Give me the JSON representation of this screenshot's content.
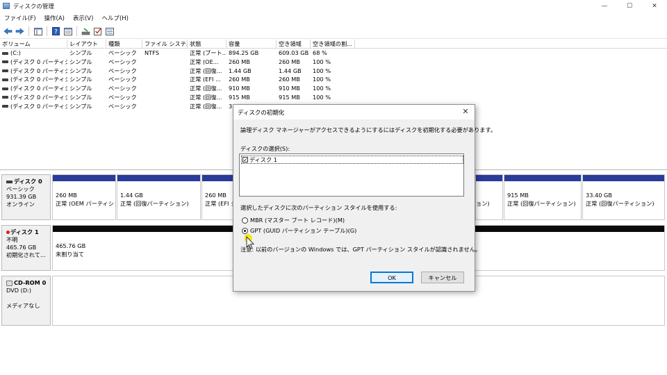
{
  "window": {
    "title": "ディスクの管理"
  },
  "menu": [
    {
      "label": "ファイル(F)"
    },
    {
      "label": "操作(A)"
    },
    {
      "label": "表示(V)"
    },
    {
      "label": "ヘルプ(H)"
    }
  ],
  "volumes": {
    "columns": [
      "ボリューム",
      "レイアウト",
      "種類",
      "ファイル システム",
      "状態",
      "容量",
      "空き領域",
      "空き領域の割..."
    ],
    "rows": [
      {
        "vol": "(C:)",
        "layout": "シンプル",
        "type": "ベーシック",
        "fs": "NTFS",
        "status": "正常 (ブート...",
        "cap": "894.25 GB",
        "free": "609.03 GB",
        "pct": "68 %"
      },
      {
        "vol": "(ディスク 0 パーティシ...",
        "layout": "シンプル",
        "type": "ベーシック",
        "fs": "",
        "status": "正常 (OE...",
        "cap": "260 MB",
        "free": "260 MB",
        "pct": "100 %"
      },
      {
        "vol": "(ディスク 0 パーティシ...",
        "layout": "シンプル",
        "type": "ベーシック",
        "fs": "",
        "status": "正常 (回復...",
        "cap": "1.44 GB",
        "free": "1.44 GB",
        "pct": "100 %"
      },
      {
        "vol": "(ディスク 0 パーティシ...",
        "layout": "シンプル",
        "type": "ベーシック",
        "fs": "",
        "status": "正常 (EFI ...",
        "cap": "260 MB",
        "free": "260 MB",
        "pct": "100 %"
      },
      {
        "vol": "(ディスク 0 パーティシ...",
        "layout": "シンプル",
        "type": "ベーシック",
        "fs": "",
        "status": "正常 (回復...",
        "cap": "910 MB",
        "free": "910 MB",
        "pct": "100 %"
      },
      {
        "vol": "(ディスク 0 パーティシ...",
        "layout": "シンプル",
        "type": "ベーシック",
        "fs": "",
        "status": "正常 (回復...",
        "cap": "915 MB",
        "free": "915 MB",
        "pct": "100 %"
      },
      {
        "vol": "(ディスク 0 パーティシ...",
        "layout": "シンプル",
        "type": "ベーシック",
        "fs": "",
        "status": "正常 (回復...",
        "cap": "3",
        "free": "",
        "pct": ""
      }
    ]
  },
  "disk0": {
    "name": "ディスク 0",
    "type": "ベーシック",
    "size": "931.39 GB",
    "state": "オンライン",
    "partitions": [
      {
        "size": "260 MB",
        "status": "正常 (OEM パーティション)"
      },
      {
        "size": "1.44 GB",
        "status": "正常 (回復パーティション)"
      },
      {
        "size": "260 MB",
        "status": "正常 (EFI シ"
      },
      {
        "size": "",
        "status": "ョン)"
      },
      {
        "size": "915 MB",
        "status": "正常 (回復パーティション)"
      },
      {
        "size": "33.40 GB",
        "status": "正常 (回復パーティション)"
      }
    ]
  },
  "disk1": {
    "name": "ディスク 1",
    "type": "不明",
    "size": "465.76 GB",
    "state": "初期化されて...",
    "part_size": "465.76 GB",
    "part_status": "未割り当て"
  },
  "cdrom": {
    "name": "CD-ROM 0",
    "drive": "DVD (D:)",
    "media": "メディアなし"
  },
  "dialog": {
    "title": "ディスクの初期化",
    "message": "論理ディスク マネージャーがアクセスできるようにするにはディスクを初期化する必要があります。",
    "select_label": "ディスクの選択(S):",
    "disk_item": "ディスク 1",
    "style_label": "選択したディスクに次のパーティション スタイルを使用する:",
    "mbr_label": "MBR (マスター ブート レコード)(M)",
    "gpt_label": "GPT (GUID パーティション テーブル)(G)",
    "note": "注意: 以前のバージョンの Windows では、GPT パーティション スタイルが認識されません。",
    "ok": "OK",
    "cancel": "キャンセル"
  }
}
